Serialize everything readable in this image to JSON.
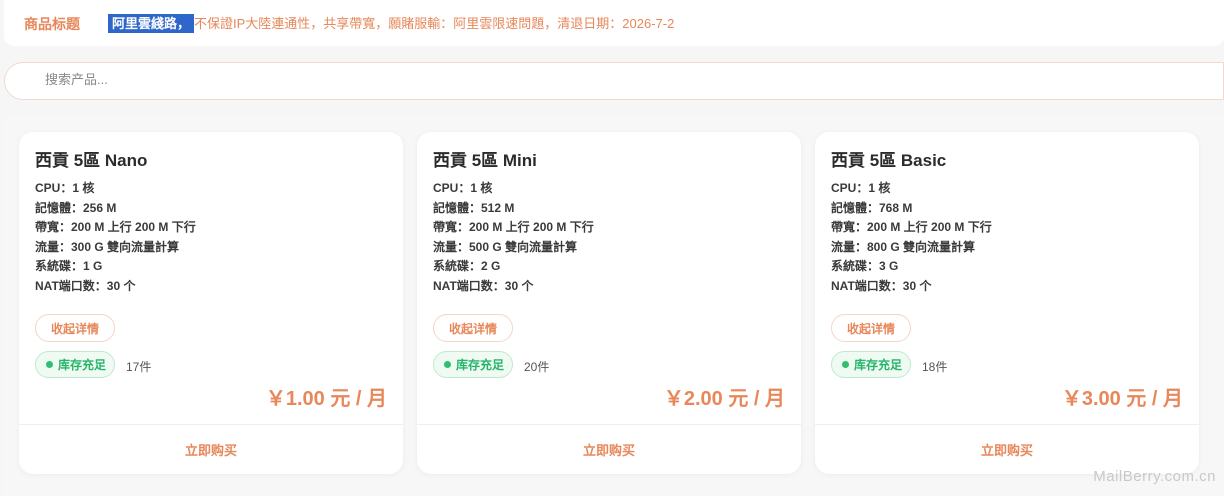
{
  "header": {
    "label": "商品标题",
    "highlight": "阿里雲綫路，",
    "text": "不保證IP大陸連通性，共享帶寬，願賭服輸：阿里雲限速問題，清退日期：2026-7-2"
  },
  "search": {
    "placeholder": "搜索产品..."
  },
  "products": [
    {
      "name": "西貢 5區 Nano",
      "specs": [
        "CPU：1 核",
        "記憶體：256 M",
        "帶寬：200 M 上行 200 M 下行",
        "流量：300 G 雙向流量計算",
        "系統碟：1 G",
        "NAT端口数：30 个"
      ],
      "collapse": "收起详情",
      "stock_status": "库存充足",
      "stock_count": "17件",
      "price": "￥1.00 元 / 月",
      "buy": "立即购买"
    },
    {
      "name": "西貢 5區 Mini",
      "specs": [
        "CPU：1 核",
        "記憶體：512 M",
        "帶寬：200 M 上行 200 M 下行",
        "流量：500 G 雙向流量計算",
        "系統碟：2 G",
        "NAT端口数：30 个"
      ],
      "collapse": "收起详情",
      "stock_status": "库存充足",
      "stock_count": "20件",
      "price": "￥2.00 元 / 月",
      "buy": "立即购买"
    },
    {
      "name": "西貢 5區 Basic",
      "specs": [
        "CPU：1 核",
        "記憶體：768 M",
        "帶寬：200 M 上行 200 M 下行",
        "流量：800 G 雙向流量計算",
        "系統碟：3 G",
        "NAT端口数：30 个"
      ],
      "collapse": "收起详情",
      "stock_status": "库存充足",
      "stock_count": "18件",
      "price": "￥3.00 元 / 月",
      "buy": "立即购买"
    }
  ],
  "watermark": "MailBerry.com.cn",
  "colors": {
    "accent": "#e8875a",
    "stock_green": "#27b56a",
    "highlight_bg": "#2f66c9"
  }
}
